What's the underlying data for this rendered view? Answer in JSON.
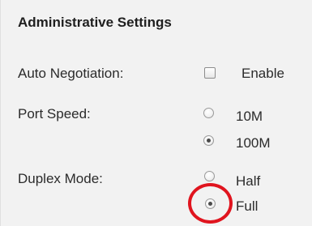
{
  "section": {
    "title": "Administrative Settings"
  },
  "auto_negotiation": {
    "label": "Auto Negotiation:",
    "checkbox_label": "Enable",
    "checked": false
  },
  "port_speed": {
    "label": "Port Speed:",
    "options": [
      {
        "label": "10M",
        "selected": false
      },
      {
        "label": "100M",
        "selected": true
      }
    ]
  },
  "duplex_mode": {
    "label": "Duplex Mode:",
    "options": [
      {
        "label": "Half",
        "selected": false
      },
      {
        "label": "Full",
        "selected": true
      }
    ]
  },
  "annotation": {
    "highlight_color": "#e0141e",
    "highlight_target": "duplex-full-radio"
  }
}
